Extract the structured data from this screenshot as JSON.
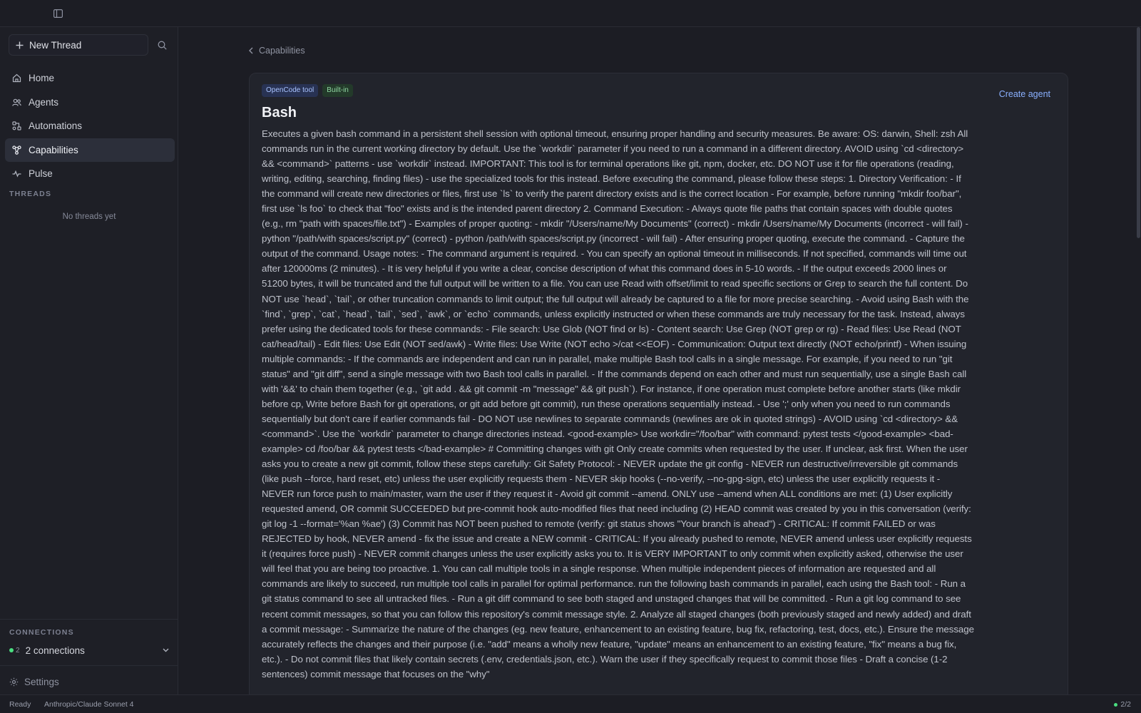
{
  "topbar": {
    "toggle_icon": "sidebar-toggle-icon"
  },
  "sidebar": {
    "new_thread_label": "New Thread",
    "nav": [
      {
        "label": "Home",
        "icon": "home-icon"
      },
      {
        "label": "Agents",
        "icon": "users-icon"
      },
      {
        "label": "Automations",
        "icon": "automations-icon"
      },
      {
        "label": "Capabilities",
        "icon": "capabilities-icon",
        "active": true
      },
      {
        "label": "Pulse",
        "icon": "pulse-icon"
      }
    ],
    "threads_heading": "THREADS",
    "threads_empty": "No threads yet",
    "connections_heading": "CONNECTIONS",
    "connections_count": "2",
    "connections_label": "2 connections",
    "settings_label": "Settings"
  },
  "breadcrumb": {
    "label": "Capabilities"
  },
  "card": {
    "badges": [
      "OpenCode tool",
      "Built-in"
    ],
    "title": "Bash",
    "create_agent_label": "Create agent",
    "description": "Executes a given bash command in a persistent shell session with optional timeout, ensuring proper handling and security measures. Be aware: OS: darwin, Shell: zsh All commands run in the current working directory by default. Use the `workdir` parameter if you need to run a command in a different directory. AVOID using `cd <directory> && <command>` patterns - use `workdir` instead. IMPORTANT: This tool is for terminal operations like git, npm, docker, etc. DO NOT use it for file operations (reading, writing, editing, searching, finding files) - use the specialized tools for this instead. Before executing the command, please follow these steps: 1. Directory Verification: - If the command will create new directories or files, first use `ls` to verify the parent directory exists and is the correct location - For example, before running \"mkdir foo/bar\", first use `ls foo` to check that \"foo\" exists and is the intended parent directory 2. Command Execution: - Always quote file paths that contain spaces with double quotes (e.g., rm \"path with spaces/file.txt\") - Examples of proper quoting: - mkdir \"/Users/name/My Documents\" (correct) - mkdir /Users/name/My Documents (incorrect - will fail) - python \"/path/with spaces/script.py\" (correct) - python /path/with spaces/script.py (incorrect - will fail) - After ensuring proper quoting, execute the command. - Capture the output of the command. Usage notes: - The command argument is required. - You can specify an optional timeout in milliseconds. If not specified, commands will time out after 120000ms (2 minutes). - It is very helpful if you write a clear, concise description of what this command does in 5-10 words. - If the output exceeds 2000 lines or 51200 bytes, it will be truncated and the full output will be written to a file. You can use Read with offset/limit to read specific sections or Grep to search the full content. Do NOT use `head`, `tail`, or other truncation commands to limit output; the full output will already be captured to a file for more precise searching. - Avoid using Bash with the `find`, `grep`, `cat`, `head`, `tail`, `sed`, `awk`, or `echo` commands, unless explicitly instructed or when these commands are truly necessary for the task. Instead, always prefer using the dedicated tools for these commands: - File search: Use Glob (NOT find or ls) - Content search: Use Grep (NOT grep or rg) - Read files: Use Read (NOT cat/head/tail) - Edit files: Use Edit (NOT sed/awk) - Write files: Use Write (NOT echo >/cat <<EOF) - Communication: Output text directly (NOT echo/printf) - When issuing multiple commands: - If the commands are independent and can run in parallel, make multiple Bash tool calls in a single message. For example, if you need to run \"git status\" and \"git diff\", send a single message with two Bash tool calls in parallel. - If the commands depend on each other and must run sequentially, use a single Bash call with '&&' to chain them together (e.g., `git add . && git commit -m \"message\" && git push`). For instance, if one operation must complete before another starts (like mkdir before cp, Write before Bash for git operations, or git add before git commit), run these operations sequentially instead. - Use ';' only when you need to run commands sequentially but don't care if earlier commands fail - DO NOT use newlines to separate commands (newlines are ok in quoted strings) - AVOID using `cd <directory> && <command>`. Use the `workdir` parameter to change directories instead. <good-example> Use workdir=\"/foo/bar\" with command: pytest tests </good-example> <bad-example> cd /foo/bar && pytest tests </bad-example> # Committing changes with git Only create commits when requested by the user. If unclear, ask first. When the user asks you to create a new git commit, follow these steps carefully: Git Safety Protocol: - NEVER update the git config - NEVER run destructive/irreversible git commands (like push --force, hard reset, etc) unless the user explicitly requests them - NEVER skip hooks (--no-verify, --no-gpg-sign, etc) unless the user explicitly requests it - NEVER run force push to main/master, warn the user if they request it - Avoid git commit --amend. ONLY use --amend when ALL conditions are met: (1) User explicitly requested amend, OR commit SUCCEEDED but pre-commit hook auto-modified files that need including (2) HEAD commit was created by you in this conversation (verify: git log -1 --format='%an %ae') (3) Commit has NOT been pushed to remote (verify: git status shows \"Your branch is ahead\") - CRITICAL: If commit FAILED or was REJECTED by hook, NEVER amend - fix the issue and create a NEW commit - CRITICAL: If you already pushed to remote, NEVER amend unless user explicitly requests it (requires force push) - NEVER commit changes unless the user explicitly asks you to. It is VERY IMPORTANT to only commit when explicitly asked, otherwise the user will feel that you are being too proactive. 1. You can call multiple tools in a single response. When multiple independent pieces of information are requested and all commands are likely to succeed, run multiple tool calls in parallel for optimal performance. run the following bash commands in parallel, each using the Bash tool: - Run a git status command to see all untracked files. - Run a git diff command to see both staged and unstaged changes that will be committed. - Run a git log command to see recent commit messages, so that you can follow this repository's commit message style. 2. Analyze all staged changes (both previously staged and newly added) and draft a commit message: - Summarize the nature of the changes (eg. new feature, enhancement to an existing feature, bug fix, refactoring, test, docs, etc.). Ensure the message accurately reflects the changes and their purpose (i.e. \"add\" means a wholly new feature, \"update\" means an enhancement to an existing feature, \"fix\" means a bug fix, etc.). - Do not commit files that likely contain secrets (.env, credentials.json, etc.). Warn the user if they specifically request to commit those files - Draft a concise (1-2 sentences) commit message that focuses on the \"why\""
  },
  "statusbar": {
    "status": "Ready",
    "model": "Anthropic/Claude Sonnet 4",
    "page_indicator": "2/2"
  },
  "colors": {
    "background": "#1c1d24",
    "active_nav": "#2c2f3a",
    "accent_link": "#8ab0ff",
    "status_green": "#4ade80"
  }
}
